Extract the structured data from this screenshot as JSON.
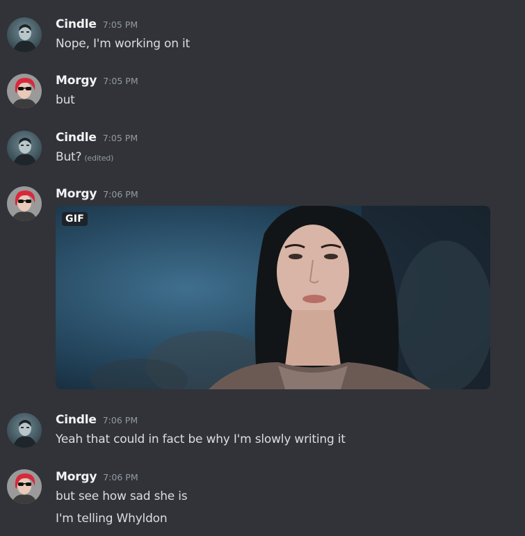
{
  "messages": [
    {
      "author": "Cindle",
      "time": "7:05 PM",
      "avatar": "cindle-avatar",
      "lines": [
        "Nope, I'm working on it"
      ]
    },
    {
      "author": "Morgy",
      "time": "7:05 PM",
      "avatar": "morgy-avatar",
      "lines": [
        "but"
      ]
    },
    {
      "author": "Cindle",
      "time": "7:05 PM",
      "avatar": "cindle-avatar",
      "lines": [
        "But?"
      ],
      "edited": "(edited)"
    },
    {
      "author": "Morgy",
      "time": "7:06 PM",
      "avatar": "morgy-avatar",
      "attachment": {
        "type": "gif",
        "badge": "GIF"
      }
    },
    {
      "author": "Cindle",
      "time": "7:06 PM",
      "avatar": "cindle-avatar",
      "lines": [
        "Yeah that could in fact be why I'm slowly writing it"
      ]
    },
    {
      "author": "Morgy",
      "time": "7:06 PM",
      "avatar": "morgy-avatar",
      "lines": [
        "but see how sad she is",
        "I'm telling Whyldon"
      ]
    }
  ],
  "colors": {
    "background": "#313338",
    "username": "#f2f3f5",
    "timestamp": "#949ba4",
    "text": "#dbdee1"
  }
}
